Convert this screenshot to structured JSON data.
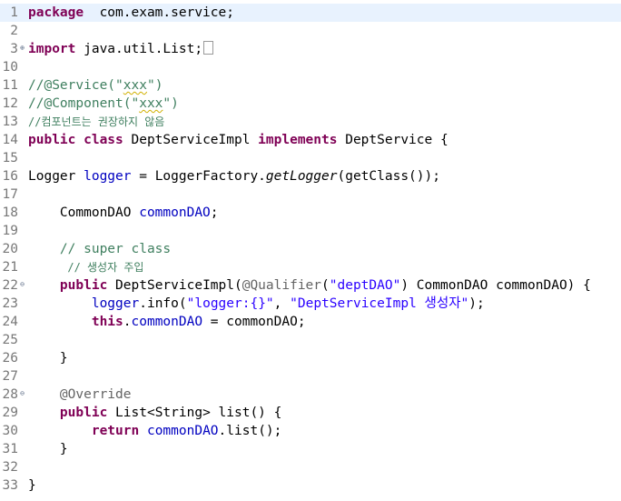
{
  "editor": {
    "lines": [
      {
        "n": "1",
        "current": true,
        "tokens": [
          [
            "kw",
            "package"
          ],
          [
            "",
            "  com.exam.service;"
          ]
        ]
      },
      {
        "n": "2",
        "tokens": []
      },
      {
        "n": "3",
        "fold": "⊕",
        "tokens": [
          [
            "kw",
            "import"
          ],
          [
            "",
            " java.util.List;"
          ],
          [
            "box",
            ""
          ]
        ]
      },
      {
        "n": "10",
        "tokens": []
      },
      {
        "n": "11",
        "tokens": [
          [
            "cm",
            "//@Service(\""
          ],
          [
            "cm squig",
            "xxx"
          ],
          [
            "cm",
            "\")"
          ]
        ]
      },
      {
        "n": "12",
        "tokens": [
          [
            "cm",
            "//@Component(\""
          ],
          [
            "cm squig",
            "xxx"
          ],
          [
            "cm",
            "\")"
          ]
        ]
      },
      {
        "n": "13",
        "kr": true,
        "tokens": [
          [
            "cm",
            "//컴포넌트는 권장하지 않음"
          ]
        ]
      },
      {
        "n": "14",
        "tokens": [
          [
            "kw",
            "public class"
          ],
          [
            "",
            " DeptServiceImpl "
          ],
          [
            "kw",
            "implements"
          ],
          [
            "",
            " DeptService {"
          ]
        ]
      },
      {
        "n": "15",
        "tokens": []
      },
      {
        "n": "16",
        "tokens": [
          [
            "",
            "Logger "
          ],
          [
            "fld",
            "logger"
          ],
          [
            "",
            " = LoggerFactory."
          ],
          [
            "ital",
            "getLogger"
          ],
          [
            "",
            "(getClass());"
          ]
        ]
      },
      {
        "n": "17",
        "tokens": []
      },
      {
        "n": "18",
        "tokens": [
          [
            "",
            "    CommonDAO "
          ],
          [
            "fld",
            "commonDAO"
          ],
          [
            "",
            ";"
          ]
        ]
      },
      {
        "n": "19",
        "tokens": []
      },
      {
        "n": "20",
        "tokens": [
          [
            "cm",
            "    // super class"
          ]
        ]
      },
      {
        "n": "21",
        "kr": true,
        "tokens": [
          [
            "cm",
            "      // 생성자 주입"
          ]
        ]
      },
      {
        "n": "22",
        "fold": "⊖",
        "tokens": [
          [
            "",
            "    "
          ],
          [
            "kw",
            "public"
          ],
          [
            "",
            " DeptServiceImpl("
          ],
          [
            "ann",
            "@Qualifier"
          ],
          [
            "",
            "("
          ],
          [
            "str",
            "\"deptDAO\""
          ],
          [
            "",
            ") CommonDAO commonDAO) {"
          ]
        ]
      },
      {
        "n": "23",
        "tokens": [
          [
            "",
            "        "
          ],
          [
            "fld",
            "logger"
          ],
          [
            "",
            ".info("
          ],
          [
            "str",
            "\"logger:{}\""
          ],
          [
            "",
            ", "
          ],
          [
            "str",
            "\"DeptServiceImpl 생성자\""
          ],
          [
            "",
            ");"
          ]
        ]
      },
      {
        "n": "24",
        "tokens": [
          [
            "",
            "        "
          ],
          [
            "kw",
            "this"
          ],
          [
            "",
            "."
          ],
          [
            "fld",
            "commonDAO"
          ],
          [
            "",
            " = commonDAO;"
          ]
        ]
      },
      {
        "n": "25",
        "tokens": []
      },
      {
        "n": "26",
        "tokens": [
          [
            "",
            "    }"
          ]
        ]
      },
      {
        "n": "27",
        "tokens": []
      },
      {
        "n": "28",
        "fold": "⊖",
        "tokens": [
          [
            "ann",
            "    @Override"
          ]
        ]
      },
      {
        "n": "29",
        "tokens": [
          [
            "",
            "    "
          ],
          [
            "kw",
            "public"
          ],
          [
            "",
            " List<String> list() {"
          ]
        ]
      },
      {
        "n": "30",
        "tokens": [
          [
            "",
            "        "
          ],
          [
            "kw",
            "return"
          ],
          [
            "",
            " "
          ],
          [
            "fld",
            "commonDAO"
          ],
          [
            "",
            ".list();"
          ]
        ]
      },
      {
        "n": "31",
        "tokens": [
          [
            "",
            "    }"
          ]
        ]
      },
      {
        "n": "32",
        "tokens": []
      },
      {
        "n": "33",
        "tokens": [
          [
            "",
            "}"
          ]
        ]
      }
    ]
  }
}
